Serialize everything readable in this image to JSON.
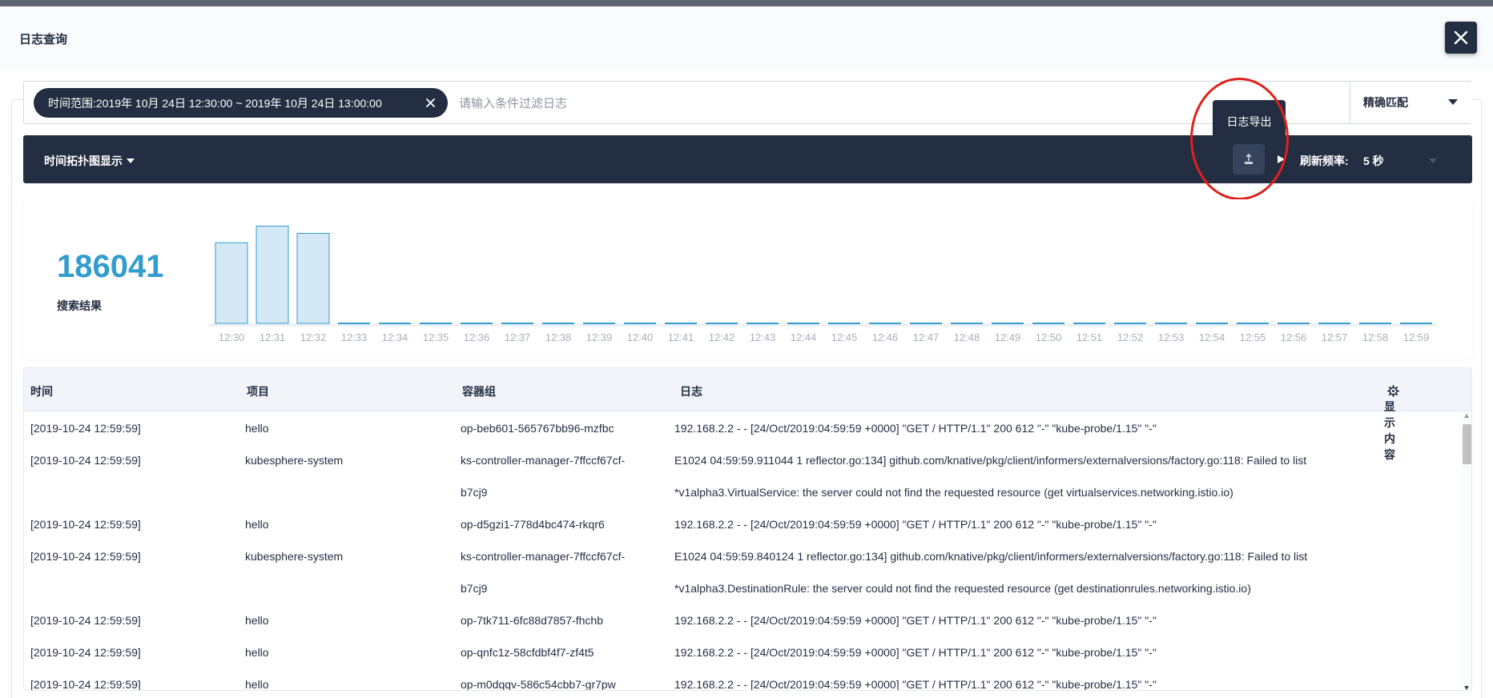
{
  "modal": {
    "title": "日志查询"
  },
  "search": {
    "tag_label": "时间范围:2019年 10月 24日 12:30:00 ~ 2019年 10月 24日 13:00:00",
    "placeholder": "请输入条件过滤日志",
    "match_mode": "精确匹配"
  },
  "toolbar": {
    "topology_toggle": "时间拓扑图显示",
    "export_tooltip": "日志导出",
    "refresh_label": "刷新频率:",
    "refresh_value": "5 秒"
  },
  "summary": {
    "total": "186041",
    "total_label": "搜索结果"
  },
  "chart_data": {
    "type": "bar",
    "categories": [
      "12:30",
      "12:31",
      "12:32",
      "12:33",
      "12:34",
      "12:35",
      "12:36",
      "12:37",
      "12:38",
      "12:39",
      "12:40",
      "12:41",
      "12:42",
      "12:43",
      "12:44",
      "12:45",
      "12:46",
      "12:47",
      "12:48",
      "12:49",
      "12:50",
      "12:51",
      "12:52",
      "12:53",
      "12:54",
      "12:55",
      "12:56",
      "12:57",
      "12:58",
      "12:59"
    ],
    "values": [
      56000,
      67500,
      62500,
      0,
      0,
      0,
      0,
      0,
      0,
      0,
      0,
      0,
      0,
      0,
      0,
      0,
      0,
      0,
      0,
      0,
      0,
      0,
      0,
      0,
      0,
      0,
      0,
      0,
      0,
      0
    ],
    "ylim": [
      0,
      70000
    ],
    "bar_color": "#329dce",
    "bar_fill": "#d4e8f6"
  },
  "table": {
    "headers": {
      "time": "时间",
      "project": "项目",
      "pod": "容器组",
      "log": "日志",
      "display": "显示内容"
    },
    "rows": [
      {
        "time": "[2019-10-24 12:59:59]",
        "project": "hello",
        "pod": [
          "op-beb601-565767bb96-mzfbc"
        ],
        "log": [
          "192.168.2.2 - - [24/Oct/2019:04:59:59 +0000] \"GET / HTTP/1.1\" 200 612 \"-\" \"kube-probe/1.15\" \"-\""
        ]
      },
      {
        "time": "[2019-10-24 12:59:59]",
        "project": "kubesphere-system",
        "pod": [
          "ks-controller-manager-7ffccf67cf-",
          "b7cj9"
        ],
        "log": [
          "E1024 04:59:59.911044 1 reflector.go:134] github.com/knative/pkg/client/informers/externalversions/factory.go:118: Failed to list",
          "*v1alpha3.VirtualService: the server could not find the requested resource (get virtualservices.networking.istio.io)"
        ]
      },
      {
        "time": "[2019-10-24 12:59:59]",
        "project": "hello",
        "pod": [
          "op-d5gzi1-778d4bc474-rkqr6"
        ],
        "log": [
          "192.168.2.2 - - [24/Oct/2019:04:59:59 +0000] \"GET / HTTP/1.1\" 200 612 \"-\" \"kube-probe/1.15\" \"-\""
        ]
      },
      {
        "time": "[2019-10-24 12:59:59]",
        "project": "kubesphere-system",
        "pod": [
          "ks-controller-manager-7ffccf67cf-",
          "b7cj9"
        ],
        "log": [
          "E1024 04:59:59.840124 1 reflector.go:134] github.com/knative/pkg/client/informers/externalversions/factory.go:118: Failed to list",
          "*v1alpha3.DestinationRule: the server could not find the requested resource (get destinationrules.networking.istio.io)"
        ]
      },
      {
        "time": "[2019-10-24 12:59:59]",
        "project": "hello",
        "pod": [
          "op-7tk711-6fc88d7857-fhchb"
        ],
        "log": [
          "192.168.2.2 - - [24/Oct/2019:04:59:59 +0000] \"GET / HTTP/1.1\" 200 612 \"-\" \"kube-probe/1.15\" \"-\""
        ]
      },
      {
        "time": "[2019-10-24 12:59:59]",
        "project": "hello",
        "pod": [
          "op-qnfc1z-58cfdbf4f7-zf4t5"
        ],
        "log": [
          "192.168.2.2 - - [24/Oct/2019:04:59:59 +0000] \"GET / HTTP/1.1\" 200 612 \"-\" \"kube-probe/1.15\" \"-\""
        ]
      },
      {
        "time": "[2019-10-24 12:59:59]",
        "project": "hello",
        "pod": [
          "op-m0dqqv-586c54cbb7-gr7pw"
        ],
        "log": [
          "192.168.2.2 - - [24/Oct/2019:04:59:59 +0000] \"GET / HTTP/1.1\" 200 612 \"-\" \"kube-probe/1.15\" \"-\""
        ]
      }
    ]
  }
}
